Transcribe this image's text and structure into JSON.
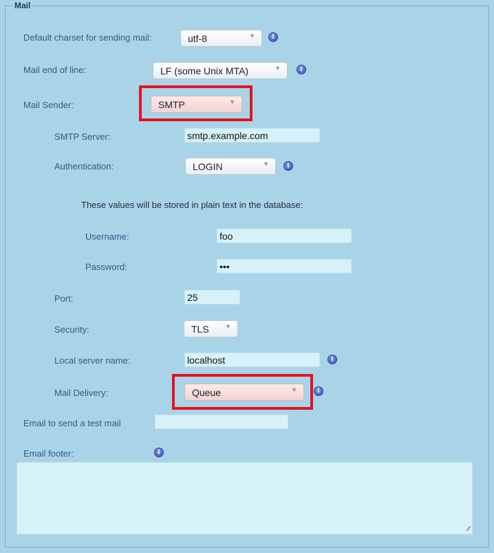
{
  "section": {
    "legend": "Mail"
  },
  "charset": {
    "label": "Default charset for sending mail:",
    "value": "utf-8"
  },
  "eol": {
    "label": "Mail end of line:",
    "value": "LF (some Unix MTA)"
  },
  "sender": {
    "label": "Mail Sender:",
    "value": "SMTP"
  },
  "smtp_server": {
    "label": "SMTP Server:",
    "value": "smtp.example.com"
  },
  "auth": {
    "label": "Authentication:",
    "value": "LOGIN"
  },
  "plaintext_note": "These values will be stored in plain text in the database:",
  "username": {
    "label": "Username:",
    "value": "foo"
  },
  "password": {
    "label": "Password:",
    "value": "•••"
  },
  "port": {
    "label": "Port:",
    "value": "25"
  },
  "security": {
    "label": "Security:",
    "value": "TLS"
  },
  "local_server": {
    "label": "Local server name:",
    "value": "localhost"
  },
  "delivery": {
    "label": "Mail Delivery:",
    "value": "Queue"
  },
  "test_mail": {
    "label": "Email to send a test mail",
    "value": ""
  },
  "footer": {
    "label": "Email footer:",
    "value": ""
  },
  "icons": {
    "info": "info-icon",
    "dropdown": "chevron-down-icon",
    "resize": "resize-grip-icon"
  },
  "glyphs": {
    "arrow": "▼",
    "info": "i",
    "grip": "⁄⁄"
  },
  "colors": {
    "highlight": "#e3131f",
    "input_bg": "#d6f2f8",
    "page_bg": "#a9d4e8"
  }
}
